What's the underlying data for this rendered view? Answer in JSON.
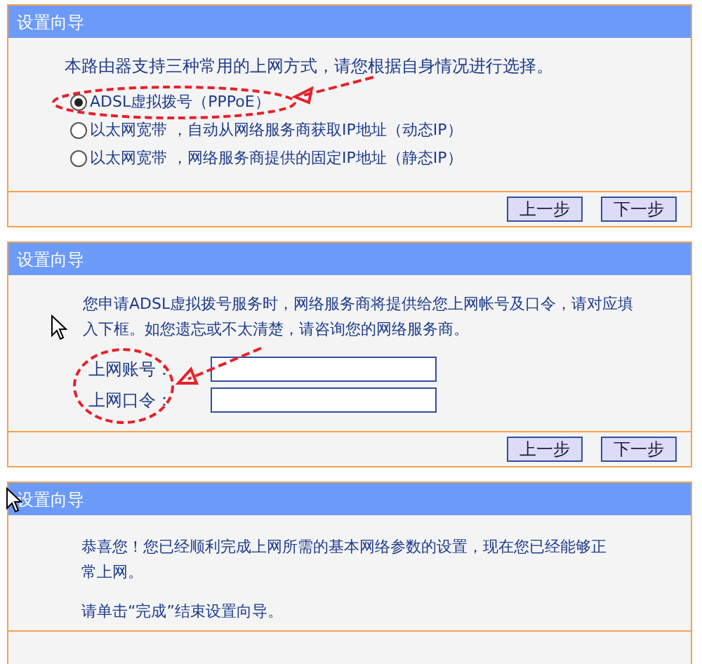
{
  "panels": [
    {
      "kind": "choice",
      "title": "设置向导",
      "intro": "本路由器支持三种常用的上网方式，请您根据自身情况进行选择。",
      "options": [
        {
          "label": "ADSL虚拟拨号（PPPoE）",
          "selected": true
        },
        {
          "label": "以太网宽带 ，自动从网络服务商获取IP地址（动态IP）",
          "selected": false
        },
        {
          "label": "以太网宽带 ，网络服务商提供的固定IP地址（静态IP）",
          "selected": false
        }
      ],
      "buttons": [
        "上一步",
        "下一步"
      ]
    },
    {
      "kind": "account",
      "title": "设置向导",
      "intro": "您申请ADSL虚拟拨号服务时，网络服务商将提供给您上网帐号及口令，请对应填入下框。如您遗忘或不太清楚，请咨询您的网络服务商。",
      "fields": [
        {
          "label": "上网账号："
        },
        {
          "label": "上网口令："
        }
      ],
      "buttons": [
        "上一步",
        "下一步"
      ]
    },
    {
      "kind": "done",
      "title": "设置向导",
      "paragraphs": [
        "恭喜您！您已经顺利完成上网所需的基本网络参数的设置，现在您已经能够正常上网。",
        "请单击“完成”结束设置向导。"
      ]
    }
  ]
}
